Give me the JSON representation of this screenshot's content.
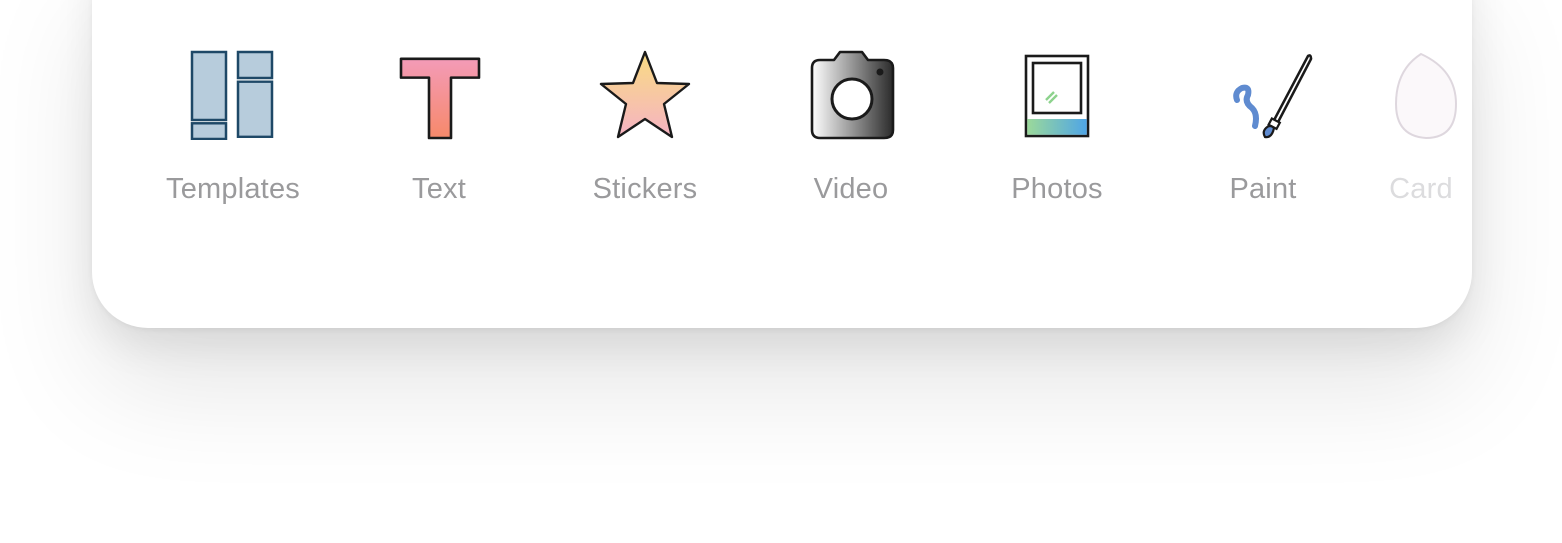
{
  "toolbar": {
    "items": [
      {
        "label": "Templates",
        "icon": "templates-icon"
      },
      {
        "label": "Text",
        "icon": "text-icon"
      },
      {
        "label": "Stickers",
        "icon": "star-icon"
      },
      {
        "label": "Video",
        "icon": "camera-icon"
      },
      {
        "label": "Photos",
        "icon": "photo-frame-icon"
      },
      {
        "label": "Paint",
        "icon": "paintbrush-icon"
      },
      {
        "label": "Card",
        "icon": "card-icon"
      }
    ]
  },
  "colors": {
    "label": "#9a9a9c",
    "label_faded": "#dcdcde",
    "templates_fill": "#b7ccdc",
    "templates_stroke": "#1e4867",
    "text_gradient_top": "#f49bb8",
    "text_gradient_bottom": "#f6896a",
    "star_gradient_top": "#f8dc82",
    "star_gradient_bottom": "#f6b3c3"
  }
}
